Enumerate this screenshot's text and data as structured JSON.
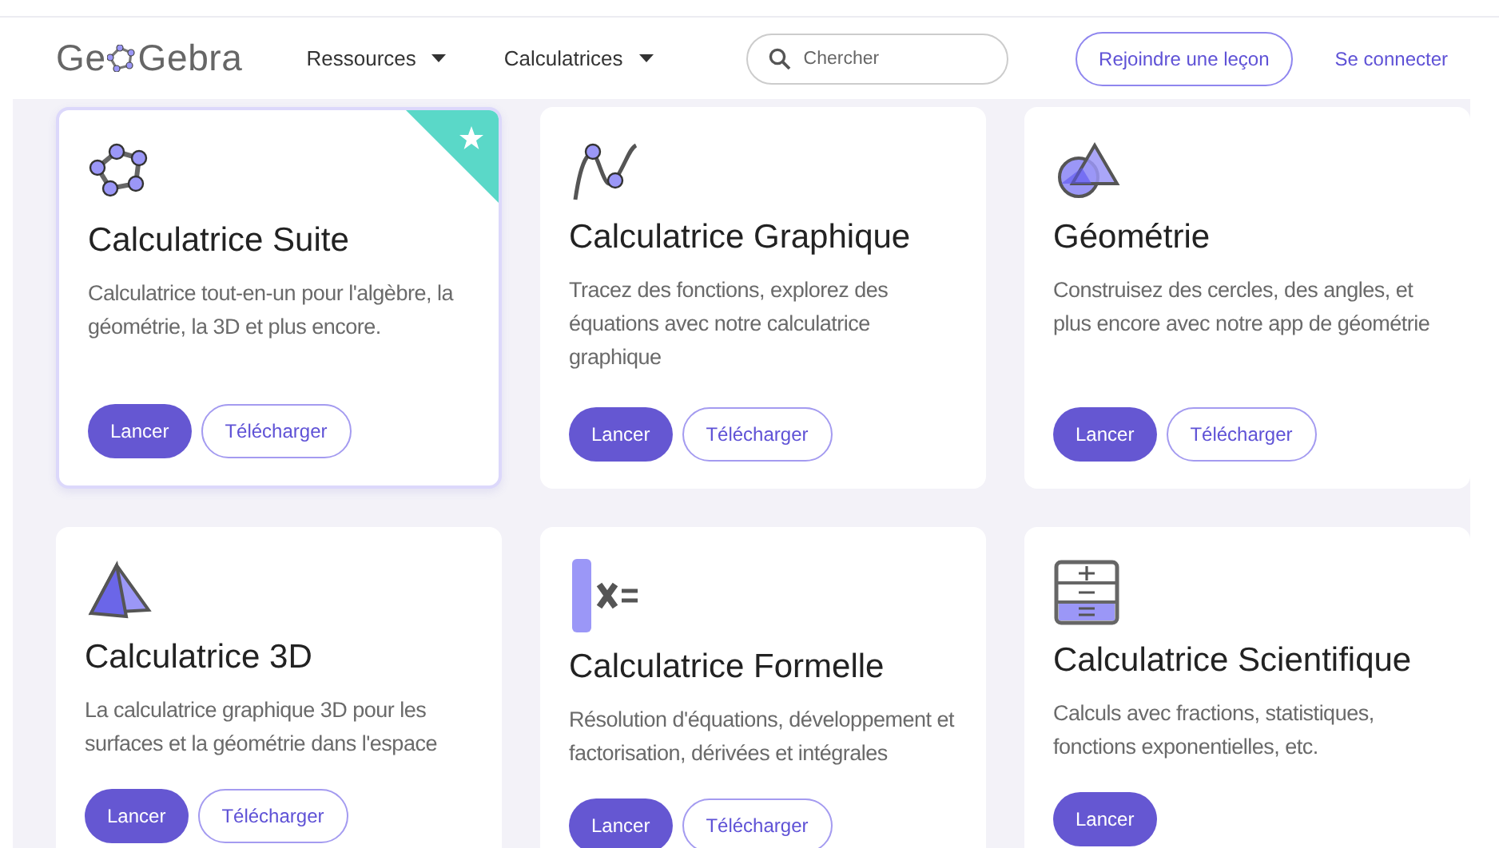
{
  "header": {
    "logo": {
      "before": "Ge",
      "after": "Gebra"
    },
    "menus": [
      {
        "label": "Ressources"
      },
      {
        "label": "Calculatrices"
      }
    ],
    "search": {
      "placeholder": "Chercher"
    },
    "join_button": "Rejoindre une leçon",
    "login_link": "Se connecter"
  },
  "cards": [
    {
      "kind": "suite",
      "featured": true,
      "title": "Calculatrice Suite",
      "description": "Calculatrice tout-en-un pour l'algèbre, la géométrie, la 3D et plus encore.",
      "buttons": [
        {
          "kind": "primary",
          "label": "Lancer"
        },
        {
          "kind": "outline",
          "label": "Télécharger"
        }
      ]
    },
    {
      "kind": "graph",
      "featured": false,
      "title": "Calculatrice Graphique",
      "description": "Tracez des fonctions, explorez des équations avec notre calculatrice graphique",
      "buttons": [
        {
          "kind": "primary",
          "label": "Lancer"
        },
        {
          "kind": "outline",
          "label": "Télécharger"
        }
      ]
    },
    {
      "kind": "geometry",
      "featured": false,
      "title": "Géométrie",
      "description": "Construisez des cercles, des angles, et plus encore avec notre app de géométrie",
      "buttons": [
        {
          "kind": "primary",
          "label": "Lancer"
        },
        {
          "kind": "outline",
          "label": "Télécharger"
        }
      ]
    },
    {
      "kind": "space",
      "featured": false,
      "title": "Calculatrice 3D",
      "description": "La calculatrice graphique 3D pour les surfaces et la géométrie dans l'espace",
      "buttons": [
        {
          "kind": "primary",
          "label": "Lancer"
        },
        {
          "kind": "outline",
          "label": "Télécharger"
        }
      ]
    },
    {
      "kind": "cas",
      "featured": false,
      "title": "Calculatrice Formelle",
      "description": "Résolution d'équations, développement et factorisation, dérivées et intégrales",
      "buttons": [
        {
          "kind": "primary",
          "label": "Lancer"
        },
        {
          "kind": "outline",
          "label": "Télécharger"
        }
      ]
    },
    {
      "kind": "scientific",
      "featured": false,
      "title": "Calculatrice Scientifique",
      "description": "Calculs avec fractions, statistiques, fonctions exponentielles, etc.",
      "buttons": [
        {
          "kind": "primary",
          "label": "Lancer"
        }
      ]
    }
  ]
}
